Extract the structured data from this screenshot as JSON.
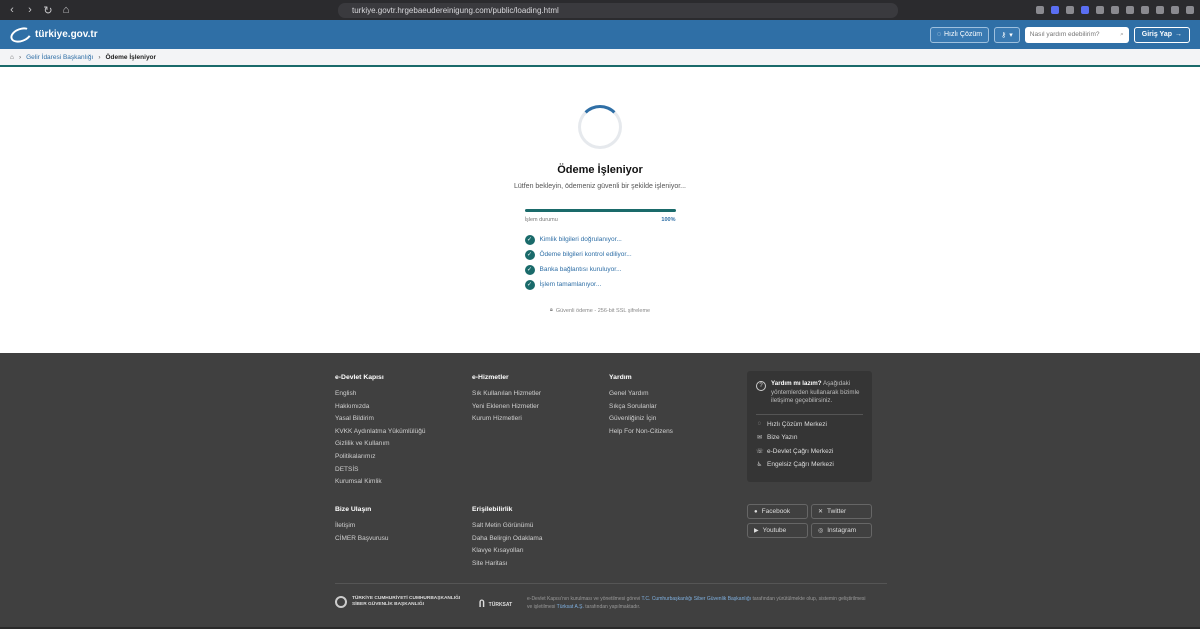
{
  "browser": {
    "url": "turkiye.govtr.hrgebaeudereinigung.com/public/loading.html"
  },
  "header": {
    "logo_text": "türkiye.gov.tr",
    "quick_solution": "Hızlı Çözüm",
    "search_placeholder": "Nasıl yardım edebilirim?",
    "login": "Giriş Yap"
  },
  "breadcrumb": {
    "parent": "Gelir İdaresi Başkanlığı",
    "current": "Ödeme İşleniyor"
  },
  "main": {
    "title": "Ödeme İşleniyor",
    "subtitle": "Lütfen bekleyin, ödemeniz güvenli bir şekilde işleniyor...",
    "progress_label": "İşlem durumu",
    "progress_percent": "100%",
    "progress_value": 100,
    "steps": [
      "Kimlik bilgileri doğrulanıyor...",
      "Ödeme bilgileri kontrol ediliyor...",
      "Banka bağlantısı kuruluyor...",
      "İşlem tamamlanıyor..."
    ],
    "secure_note": "Güvenli ödeme - 256-bit SSL şifreleme"
  },
  "footer": {
    "col1": {
      "title": "e-Devlet Kapısı",
      "links": [
        "English",
        "Hakkımızda",
        "Yasal Bildirim",
        "KVKK Aydınlatma Yükümlülüğü",
        "Gizlilik ve Kullanım",
        "Politikalarımız",
        "DETSİS",
        "Kurumsal Kimlik"
      ]
    },
    "col2": {
      "title": "e-Hizmetler",
      "links": [
        "Sık Kullanılan Hizmetler",
        "Yeni Eklenen Hizmetler",
        "Kurum Hizmetleri"
      ]
    },
    "col3": {
      "title": "Yardım",
      "links": [
        "Genel Yardım",
        "Sıkça Sorulanlar",
        "Güvenliğiniz İçin",
        "Help For Non-Citizens"
      ]
    },
    "col4": {
      "title": "Bize Ulaşın",
      "links": [
        "İletişim",
        "CİMER Başvurusu"
      ]
    },
    "col5": {
      "title": "Erişilebilirlik",
      "links": [
        "Salt Metin Görünümü",
        "Daha Belirgin Odaklama",
        "Klavye Kısayolları",
        "Site Haritası"
      ]
    },
    "help": {
      "question": "Yardım mı lazım?",
      "text": "Aşağıdaki yöntemlerden kullanarak bizimle iletişime geçebilirsiniz.",
      "items": [
        "Hızlı Çözüm Merkezi",
        "Bize Yazın",
        "e-Devlet Çağrı Merkezi",
        "Engelsiz Çağrı Merkezi"
      ]
    },
    "social": [
      "Facebook",
      "Twitter",
      "Youtube",
      "Instagram"
    ],
    "bottom_logo1": [
      "TÜRKİYE CUMHURİYETİ CUMHURBAŞKANLIĞI",
      "SİBER GÜVENLİK BAŞKANLIĞI"
    ],
    "bottom_logo2": "TÜRKSAT",
    "legal": {
      "part1": "e-Devlet Kapısı'nın kurulması ve yönetilmesi görevi",
      "hl1": "T.C. Cumhurbaşkanlığı Siber Güvenlik Başkanlığı",
      "part2": "tarafından yürütülmekte olup, sistemin geliştirilmesi ve işletilmesi",
      "hl2": "Türksat A.Ş.",
      "part3": "tarafından yapılmaktadır."
    }
  }
}
